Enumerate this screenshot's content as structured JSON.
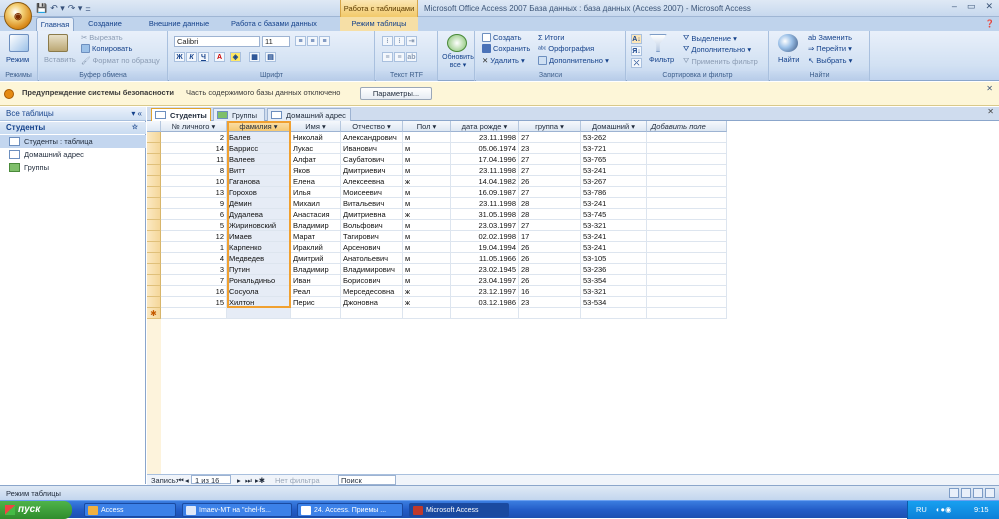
{
  "app": {
    "quick_access": [
      "💾",
      "↶ ▾",
      "↷ ▾",
      "="
    ],
    "context_tab": "Работа с таблицами",
    "window_title": "Microsoft Office Access 2007 База данных : база данных (Access 2007) - Microsoft Access",
    "window_controls": [
      "–",
      "▭",
      "✕"
    ]
  },
  "ribbon_tabs": [
    {
      "label": "Главная",
      "active": true
    },
    {
      "label": "Создание",
      "active": false
    },
    {
      "label": "Внешние данные",
      "active": false
    },
    {
      "label": "Работа с базами данных",
      "active": false
    },
    {
      "label": "Режим таблицы",
      "active": false
    }
  ],
  "ribbon": {
    "views": {
      "label": "Режимы",
      "mode": "Режим"
    },
    "clipboard": {
      "label": "Буфер обмена",
      "paste": "Вставить",
      "cut": "Вырезать",
      "copy": "Копировать",
      "format_painter": "Формат по образцу"
    },
    "font": {
      "label": "Шрифт",
      "font_name": "Calibri",
      "font_size": "11"
    },
    "rich_text": {
      "label": "Текст RTF"
    },
    "refresh": {
      "label": "Обновить все ▾"
    },
    "records": {
      "label": "Записи",
      "new": "Создать",
      "save": "Сохранить",
      "delete": "Удалить ▾",
      "totals": "Итоги",
      "spelling": "Орфография",
      "more": "Дополнительно ▾"
    },
    "sort_filter": {
      "label": "Сортировка и фильтр",
      "filter": "Фильтр",
      "selection": "Выделение ▾",
      "advanced": "Дополнительно ▾",
      "toggle": "Применить фильтр"
    },
    "find": {
      "label": "Найти",
      "find": "Найти",
      "replace": "Заменить",
      "goto": "Перейти ▾",
      "select": "Выбрать ▾"
    }
  },
  "security": {
    "title": "Предупреждение системы безопасности",
    "text": "Часть содержимого базы данных отключено",
    "button": "Параметры..."
  },
  "nav": {
    "header": "Все таблицы",
    "header_ctrl": "▾ «",
    "group": "Студенты",
    "group_ctrl": "☆",
    "items": [
      {
        "label": "Студенты : таблица",
        "selected": true,
        "icon": "table-icon"
      },
      {
        "label": "Домашний адрес",
        "selected": false,
        "icon": "table-icon"
      },
      {
        "label": "Группы",
        "selected": false,
        "icon": "group-icon"
      }
    ]
  },
  "doc_tabs": [
    {
      "label": "Студенты",
      "active": true
    },
    {
      "label": "Группы",
      "active": false
    },
    {
      "label": "Домашний адрес",
      "active": false
    }
  ],
  "table": {
    "columns": [
      "№ личного ▾",
      "фамилия ▾",
      "Имя ▾",
      "Отчество ▾",
      "Пол ▾",
      "дата рожде ▾",
      "группа ▾",
      "Домашний ▾",
      "Добавить поле"
    ],
    "rows": [
      [
        "2",
        "Балев",
        "Николай",
        "Александрович",
        "м",
        "23.11.1998",
        "27",
        "53-262"
      ],
      [
        "14",
        "Баррисс",
        "Лукас",
        "Иванович",
        "м",
        "05.06.1974",
        "23",
        "53-721"
      ],
      [
        "11",
        "Валеев",
        "Алфат",
        "Саубатович",
        "м",
        "17.04.1996",
        "27",
        "53-765"
      ],
      [
        "8",
        "Витт",
        "Яков",
        "Дмитриевич",
        "м",
        "23.11.1998",
        "27",
        "53-241"
      ],
      [
        "10",
        "Гаганова",
        "Елена",
        "Алексеевна",
        "ж",
        "14.04.1982",
        "26",
        "53-267"
      ],
      [
        "13",
        "Горохов",
        "Илья",
        "Моисеевич",
        "м",
        "16.09.1987",
        "27",
        "53-786"
      ],
      [
        "9",
        "Дёмин",
        "Михаил",
        "Витальевич",
        "м",
        "23.11.1998",
        "28",
        "53-241"
      ],
      [
        "6",
        "Дудалева",
        "Анастасия",
        "Дмитриевна",
        "ж",
        "31.05.1998",
        "28",
        "53-745"
      ],
      [
        "5",
        "Жириновский",
        "Владимир",
        "Вольфович",
        "м",
        "23.03.1997",
        "27",
        "53-321"
      ],
      [
        "12",
        "Имаев",
        "Марат",
        "Тагирович",
        "м",
        "02.02.1998",
        "17",
        "53-241"
      ],
      [
        "1",
        "Карпенко",
        "Ираклий",
        "Арсенович",
        "м",
        "19.04.1994",
        "26",
        "53-241"
      ],
      [
        "4",
        "Медведев",
        "Дмитрий",
        "Анатольевич",
        "м",
        "11.05.1966",
        "26",
        "53-105"
      ],
      [
        "3",
        "Путин",
        "Владимир",
        "Владимирович",
        "м",
        "23.02.1945",
        "28",
        "53-236"
      ],
      [
        "7",
        "Рональдиньо",
        "Иван",
        "Борисович",
        "м",
        "23.04.1997",
        "26",
        "53-354"
      ],
      [
        "16",
        "Сосуола",
        "Реал",
        "Мерседесовна",
        "ж",
        "23.12.1997",
        "16",
        "53-321"
      ],
      [
        "15",
        "Хилтон",
        "Перис",
        "Джоновна",
        "ж",
        "03.12.1986",
        "23",
        "53-534"
      ]
    ],
    "new_row_marker": "✱"
  },
  "record_nav": {
    "label": "Запись:",
    "first": "⏮",
    "prev": "◂",
    "position": "1 из 16",
    "next": "▸",
    "last": "⏭",
    "new": "▸✱",
    "filter": "Нет фильтра",
    "search": "Поиск"
  },
  "status": {
    "text": "Режим таблицы"
  },
  "taskbar": {
    "start": "пуск",
    "tasks": [
      {
        "label": "Access",
        "active": false
      },
      {
        "label": "Imaev-MT на \"chel-fs...",
        "active": false
      },
      {
        "label": "24. Access. Приемы ...",
        "active": false
      },
      {
        "label": "Microsoft Access",
        "active": true
      }
    ],
    "lang": "RU",
    "clock": "9:15"
  }
}
